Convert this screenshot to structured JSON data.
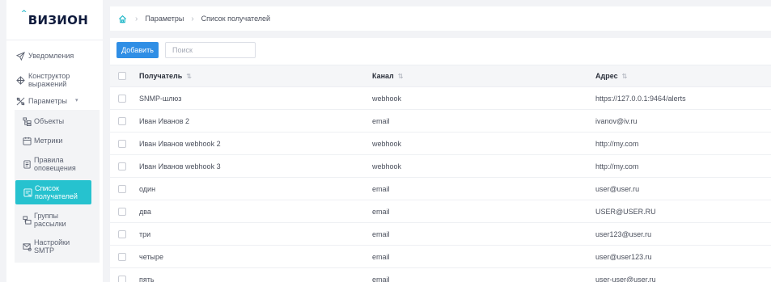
{
  "app": {
    "logo_caret": "^",
    "logo_text": "ВИЗИОН"
  },
  "sidebar": {
    "items": [
      {
        "label": "Уведомления",
        "icon": "send-icon"
      },
      {
        "label": "Конструктор выражений",
        "icon": "expression-icon"
      },
      {
        "label": "Параметры",
        "icon": "settings-icon",
        "expanded": true
      }
    ],
    "sub_items": [
      {
        "label": "Объекты",
        "icon": "objects-icon"
      },
      {
        "label": "Метрики",
        "icon": "metrics-icon"
      },
      {
        "label": "Правила оповещения",
        "icon": "rules-icon"
      },
      {
        "label": "Список получателей",
        "icon": "recipients-icon",
        "active": true
      },
      {
        "label": "Группы рассылки",
        "icon": "groups-icon"
      },
      {
        "label": "Настройки SMTP",
        "icon": "mail-settings-icon"
      }
    ]
  },
  "breadcrumb": {
    "home_icon": "home-icon",
    "items": [
      "Параметры",
      "Список получателей"
    ]
  },
  "toolbar": {
    "add_label": "Добавить",
    "search_placeholder": "Поиск",
    "search_value": ""
  },
  "table": {
    "columns": [
      {
        "label": "Получатель",
        "sortable": true
      },
      {
        "label": "Канал",
        "sortable": true
      },
      {
        "label": "Адрес",
        "sortable": true
      }
    ],
    "sort_glyph": "⇅",
    "rows": [
      {
        "name": "SNMP-шлюз",
        "channel": "webhook",
        "address": "https://127.0.0.1:9464/alerts"
      },
      {
        "name": "Иван Иванов 2",
        "channel": "email",
        "address": "ivanov@iv.ru"
      },
      {
        "name": "Иван Иванов webhook 2",
        "channel": "webhook",
        "address": "http://my.com"
      },
      {
        "name": "Иван Иванов webhook 3",
        "channel": "webhook",
        "address": "http://my.com"
      },
      {
        "name": "один",
        "channel": "email",
        "address": "user@user.ru"
      },
      {
        "name": "два",
        "channel": "email",
        "address": "USER@USER.RU"
      },
      {
        "name": "три",
        "channel": "email",
        "address": "user123@user.ru"
      },
      {
        "name": "четыре",
        "channel": "email",
        "address": "user@user123.ru"
      },
      {
        "name": "пять",
        "channel": "email",
        "address": "user-user@user.ru"
      }
    ]
  },
  "colors": {
    "accent": "#26c2cf",
    "primary_button": "#2f8ee5",
    "page_bg": "#f2f3f6"
  }
}
